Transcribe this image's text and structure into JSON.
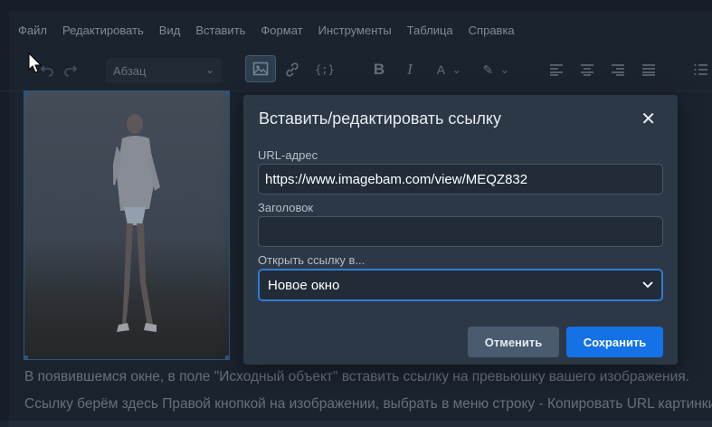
{
  "menubar": {
    "items": [
      "Файл",
      "Редактировать",
      "Вид",
      "Вставить",
      "Формат",
      "Инструменты",
      "Таблица",
      "Справка"
    ]
  },
  "toolbar": {
    "format_select_value": "Абзац",
    "icons": [
      "undo-icon",
      "redo-icon",
      "image-icon",
      "link-icon",
      "code-icon",
      "bold-icon",
      "italic-icon",
      "text-color-icon",
      "highlight-icon",
      "align-left-icon",
      "align-center-icon",
      "align-right-icon",
      "align-justify-icon",
      "list-icon"
    ]
  },
  "content": {
    "line1": "В появившемся окне, в поле \"Исходный объект\" вставить ссылку на превьюшку вашего изображения.",
    "line2": "Ссылку берём здесь Правой кнопкой на изображении, выбрать в меню строку - Копировать URL картинки"
  },
  "dialog": {
    "title": "Вставить/редактировать ссылку",
    "close_glyph": "✕",
    "url_label": "URL-адрес",
    "url_value": "https://www.imagebam.com/view/MEQZ832",
    "title_label": "Заголовок",
    "title_value": "",
    "open_in_label": "Открыть ссылку в...",
    "open_in_value": "Новое окно",
    "cancel_label": "Отменить",
    "save_label": "Сохранить"
  },
  "colors": {
    "accent": "#1472e6",
    "background": "#1c2531",
    "dialog": "#2d3847"
  }
}
